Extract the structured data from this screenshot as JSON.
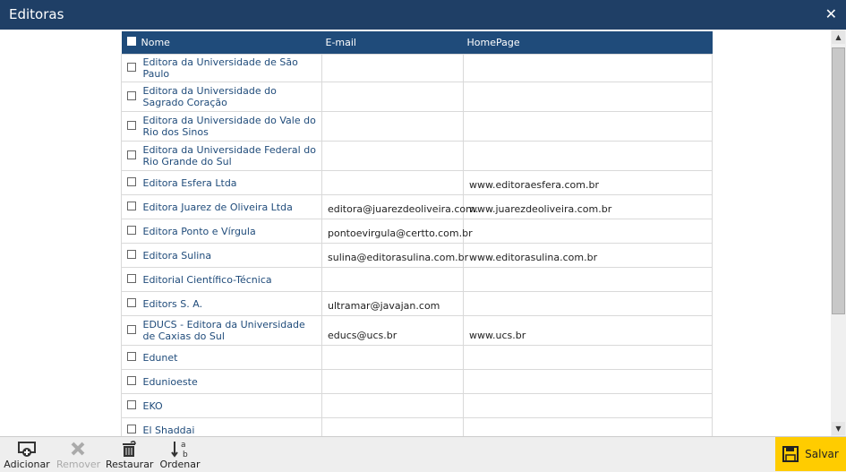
{
  "dialog": {
    "title": "Editoras"
  },
  "table": {
    "columns": {
      "name": "Nome",
      "email": "E-mail",
      "homepage": "HomePage"
    },
    "rows": [
      {
        "name": "Editora da Universidade de São Paulo",
        "email": "",
        "homepage": ""
      },
      {
        "name": "Editora da Universidade do Sagrado Coração",
        "email": "",
        "homepage": ""
      },
      {
        "name": "Editora da Universidade do Vale do Rio dos Sinos",
        "email": "",
        "homepage": ""
      },
      {
        "name": "Editora da Universidade Federal do Rio Grande do Sul",
        "email": "",
        "homepage": ""
      },
      {
        "name": "Editora Esfera Ltda",
        "email": "",
        "homepage": "www.editoraesfera.com.br"
      },
      {
        "name": "Editora Juarez de Oliveira Ltda",
        "email": "editora@juarezdeoliveira.com.",
        "homepage": "www.juarezdeoliveira.com.br"
      },
      {
        "name": "Editora Ponto e Vírgula",
        "email": "pontoevirgula@certto.com.br",
        "homepage": ""
      },
      {
        "name": "Editora Sulina",
        "email": "sulina@editorasulina.com.br",
        "homepage": "www.editorasulina.com.br"
      },
      {
        "name": "Editorial Científico-Técnica",
        "email": "",
        "homepage": ""
      },
      {
        "name": "Editors S. A.",
        "email": "ultramar@javajan.com",
        "homepage": ""
      },
      {
        "name": "EDUCS - Editora da Universidade de Caxias do Sul",
        "email": "educs@ucs.br",
        "homepage": "www.ucs.br"
      },
      {
        "name": "Edunet",
        "email": "",
        "homepage": ""
      },
      {
        "name": "Edunioeste",
        "email": "",
        "homepage": ""
      },
      {
        "name": "EKO",
        "email": "",
        "homepage": ""
      },
      {
        "name": "El Shaddai",
        "email": "",
        "homepage": ""
      }
    ]
  },
  "toolbar": {
    "add_label": "Adicionar",
    "remove_label": "Remover",
    "restore_label": "Restaurar",
    "sort_label": "Ordenar",
    "save_label": "Salvar"
  },
  "colors": {
    "header": "#1f3f66",
    "table_header": "#1f4b7a",
    "link": "#1f4b7a",
    "save_button": "#ffcc00"
  }
}
